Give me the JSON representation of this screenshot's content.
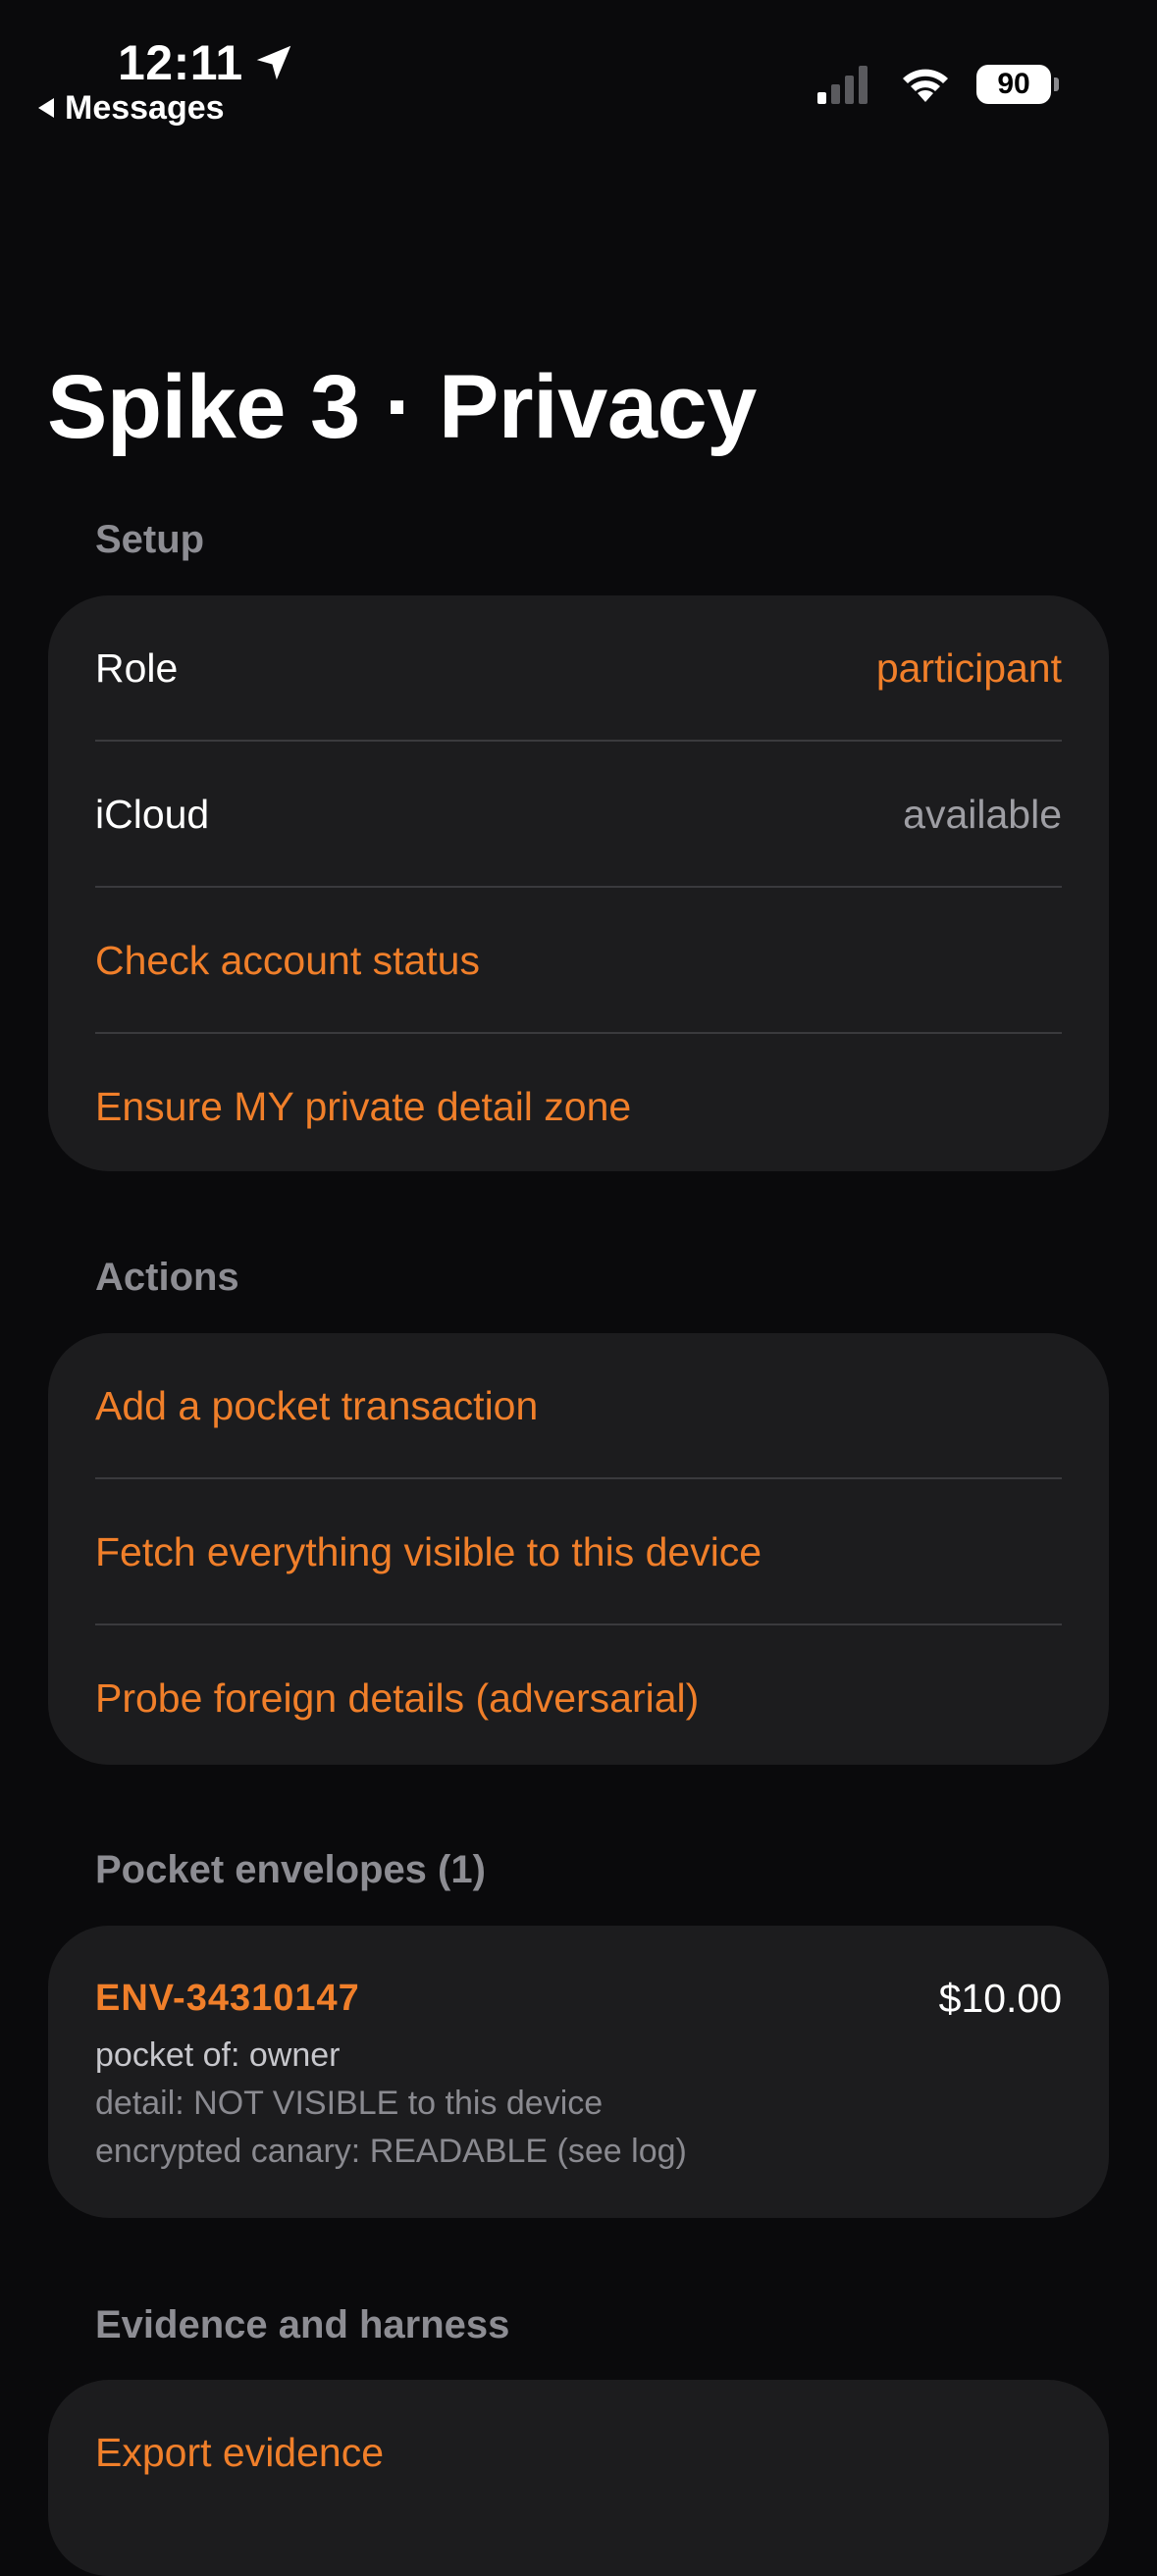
{
  "status_bar": {
    "time": "12:11",
    "back_label": "Messages",
    "battery": "90",
    "location_icon": "location-arrow-icon",
    "signal_icon": "cellular-signal-icon",
    "wifi_icon": "wifi-icon"
  },
  "title": "Spike 3 · Privacy",
  "setup": {
    "header": "Setup",
    "role_label": "Role",
    "role_value": "participant",
    "icloud_label": "iCloud",
    "icloud_value": "available",
    "check_account": "Check account status",
    "ensure_zone": "Ensure MY private detail zone"
  },
  "actions": {
    "header": "Actions",
    "add_transaction": "Add a pocket transaction",
    "fetch_visible": "Fetch everything visible to this device",
    "probe_foreign": "Probe foreign details (adversarial)"
  },
  "envelopes": {
    "header": "Pocket envelopes (1)",
    "items": [
      {
        "id": "ENV-34310147",
        "amount": "$10.00",
        "owner_line": "pocket of: owner",
        "detail_line": "detail: NOT VISIBLE to this device",
        "canary_line": "encrypted canary: READABLE (see log)"
      }
    ]
  },
  "evidence": {
    "header": "Evidence and harness",
    "export": "Export evidence"
  },
  "colors": {
    "background": "#0a0a0c",
    "card": "#1c1c1e",
    "accent": "#f07f2a",
    "section_header": "#8d8d93"
  }
}
